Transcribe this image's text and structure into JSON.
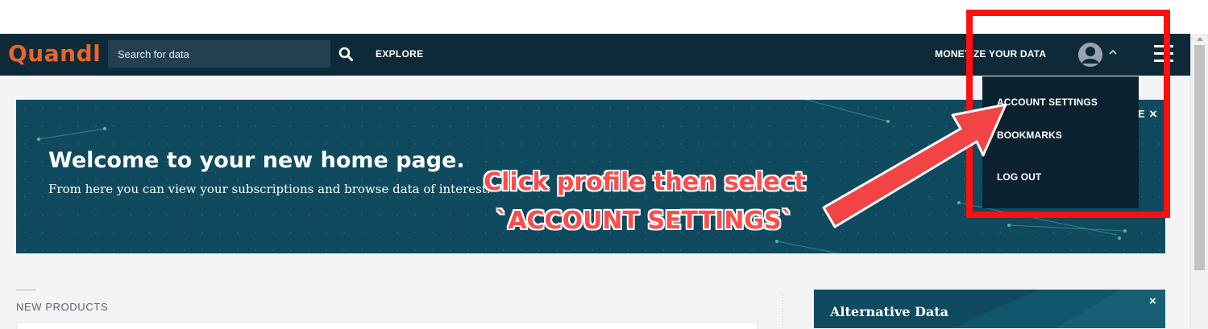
{
  "app": {
    "logo": "Quandl"
  },
  "nav": {
    "search_placeholder": "Search for data",
    "explore": "EXPLORE",
    "monetize": "MONETIZE YOUR DATA"
  },
  "profile_menu": {
    "items": [
      {
        "label": "ACCOUNT SETTINGS"
      },
      {
        "label": "BOOKMARKS"
      },
      {
        "label": "LOG OUT"
      }
    ]
  },
  "banner": {
    "title": "Welcome to your new home page.",
    "subtitle": "From here you can view your subscriptions and browse data of interest.",
    "close": "×"
  },
  "annotation": {
    "line1": "Click profile then select",
    "line2": "`ACCOUNT SETTINGS`",
    "color": "#ff3b3b"
  },
  "sections": {
    "new_products": "NEW PRODUCTS",
    "alt_card_title": "Alternative Data",
    "alt_card_close": "×"
  },
  "colors": {
    "navbar": "#0e2a38",
    "brand": "#e8642b",
    "banner": "#0f4a5f"
  }
}
